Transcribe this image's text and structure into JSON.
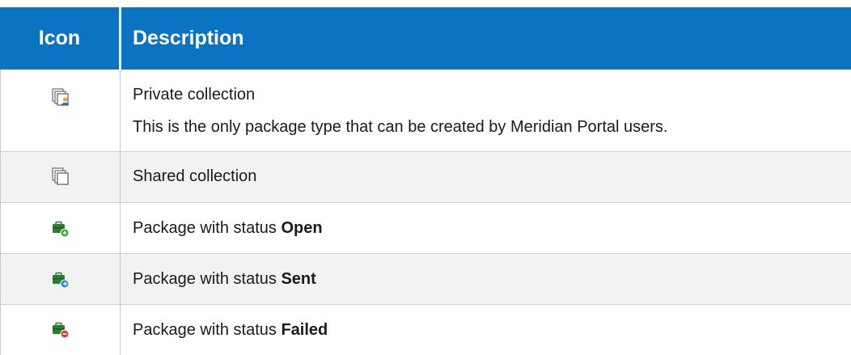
{
  "header": {
    "icon_col": "Icon",
    "desc_col": "Description"
  },
  "rows": [
    {
      "icon": "private-collection-icon",
      "title": "Private collection",
      "note": "This is the only package type that can be created by Meridian Portal users."
    },
    {
      "icon": "shared-collection-icon",
      "title": "Shared collection"
    },
    {
      "icon": "package-open-icon",
      "prefix": "Package with status ",
      "status": "Open"
    },
    {
      "icon": "package-sent-icon",
      "prefix": "Package with status ",
      "status": "Sent"
    },
    {
      "icon": "package-failed-icon",
      "prefix": "Package with status ",
      "status": "Failed"
    }
  ],
  "colors": {
    "header_bg": "#0b74c2",
    "row_alt_bg": "#f2f2f2",
    "status_open": "#3fae3f",
    "status_sent": "#1e88e5",
    "status_failed": "#e53935"
  }
}
